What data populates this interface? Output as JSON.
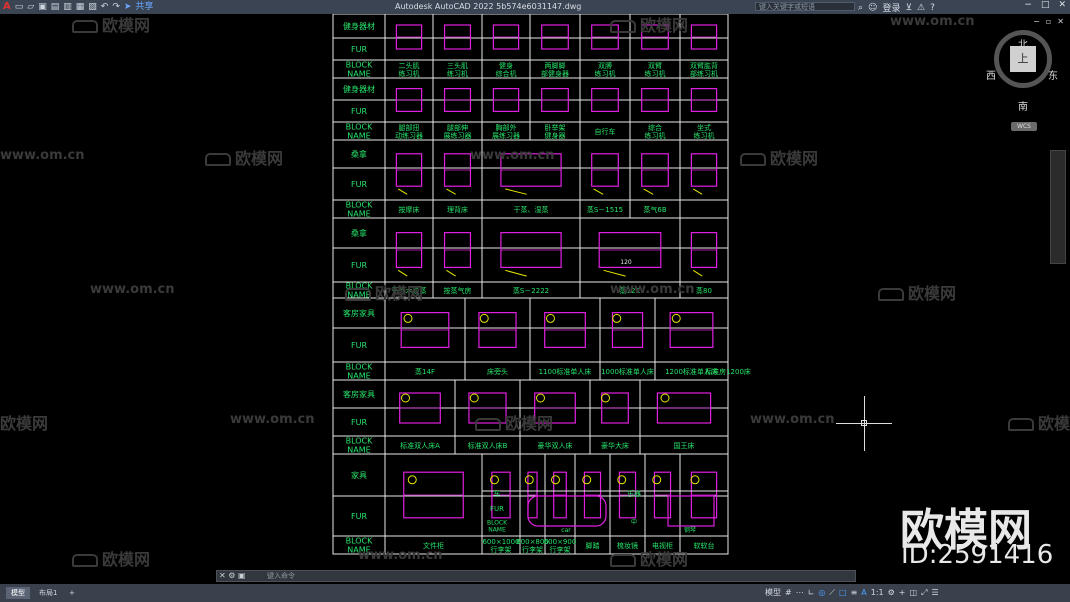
{
  "titlebar": {
    "title": "Autodesk AutoCAD 2022    5b574e6031147.dwg",
    "share": "共享",
    "search_placeholder": "键入关键字或短语",
    "login": "登录"
  },
  "qa_icons": [
    "autocad-logo",
    "new-icon",
    "open-icon",
    "save-icon",
    "save-as-icon",
    "plot-icon",
    "publish-icon",
    "print-icon",
    "undo-icon",
    "redo-icon",
    "share-icon"
  ],
  "viewcube": {
    "north": "北",
    "south": "南",
    "east": "东",
    "west": "西",
    "face": "上",
    "wcs": "WCS"
  },
  "cmd": {
    "close": "✕",
    "wrench": "🔧",
    "prompt_placeholder": "键入命令"
  },
  "status": {
    "tabs": [
      "模型",
      "布局1"
    ],
    "add": "+",
    "model": "模型",
    "scale": "1:1"
  },
  "watermarks": {
    "brand": "欧模网",
    "url": "www.om.cn",
    "big_brand": "欧模网",
    "big_id": "ID:2591416"
  },
  "colors": {
    "bg": "#000000",
    "grid": "#e8e8e8",
    "label": "#27e36a",
    "symbol": "#e020e0",
    "yellow": "#e6e600",
    "accent_blue": "#4aa3ff"
  },
  "sheet": {
    "rows": [
      {
        "kind": "header",
        "label": "健身器材"
      },
      {
        "kind": "fur",
        "label": "FUR"
      },
      {
        "kind": "name",
        "label": "BLOCK\nNAME",
        "names": [
          "二头肌\n练习机",
          "三头肌\n练习机",
          "健身\n综合机",
          "两脚脚\n部健身器",
          "双膊\n练习机",
          "双臂\n练习机",
          "双臂肱背\n部练习机"
        ]
      },
      {
        "kind": "header",
        "label": "健身器材"
      },
      {
        "kind": "fur",
        "label": "FUR"
      },
      {
        "kind": "name",
        "label": "BLOCK\nNAME",
        "names": [
          "腿部扭\n动练习器",
          "腿部伸\n展练习器",
          "胸部外\n展练习器",
          "卧举架\n健身器",
          "自行车",
          "综合\n练习机",
          "坐式\n练习机"
        ]
      },
      {
        "kind": "header",
        "label": "桑拿"
      },
      {
        "kind": "fur",
        "label": "FUR"
      },
      {
        "kind": "name",
        "label": "BLOCK\nNAME",
        "names": [
          "按摩床",
          "理背床",
          "干蒸、湿蒸",
          "蒸S－1515",
          "蒸气6B"
        ]
      },
      {
        "kind": "header",
        "label": "桑拿"
      },
      {
        "kind": "fur",
        "label": "FUR"
      },
      {
        "kind": "name",
        "label": "BLOCK\nNAME",
        "names": [
          "干气木纹蒸",
          "按蒸气房",
          "蒸S－2222",
          "蒸12C",
          "蒸80"
        ]
      },
      {
        "kind": "header",
        "label": "客房家具"
      },
      {
        "kind": "fur",
        "label": "FUR"
      },
      {
        "kind": "name",
        "label": "BLOCK\nNAME",
        "names": [
          "蒸14F",
          "床旁头",
          "1100标准单人床",
          "1000标准单人床",
          "1200标准单人床",
          "标准房1200床"
        ]
      },
      {
        "kind": "header",
        "label": "客房家具"
      },
      {
        "kind": "fur",
        "label": "FUR"
      },
      {
        "kind": "name",
        "label": "BLOCK\nNAME",
        "names": [
          "标准双人床A",
          "标准双人床B",
          "豪华双人床",
          "豪华大床",
          "国王床"
        ]
      },
      {
        "kind": "header",
        "label": "家具"
      },
      {
        "kind": "fur",
        "label": "FUR"
      },
      {
        "kind": "name",
        "label": "BLOCK\nNAME",
        "names": [
          "文件柜",
          "600×1000\n行李架",
          "600×800\n行李架",
          "600×900\n行李架",
          "脚踏",
          "梳妆镜",
          "电视柜",
          "软软台"
        ]
      }
    ],
    "sub": {
      "car": "车",
      "fur": "FUR",
      "block": "BLOCK\nNAME",
      "car_name": "car",
      "music": "乐器",
      "grand": "钢琴",
      "zhong": "中"
    },
    "sauna_size": "120"
  }
}
